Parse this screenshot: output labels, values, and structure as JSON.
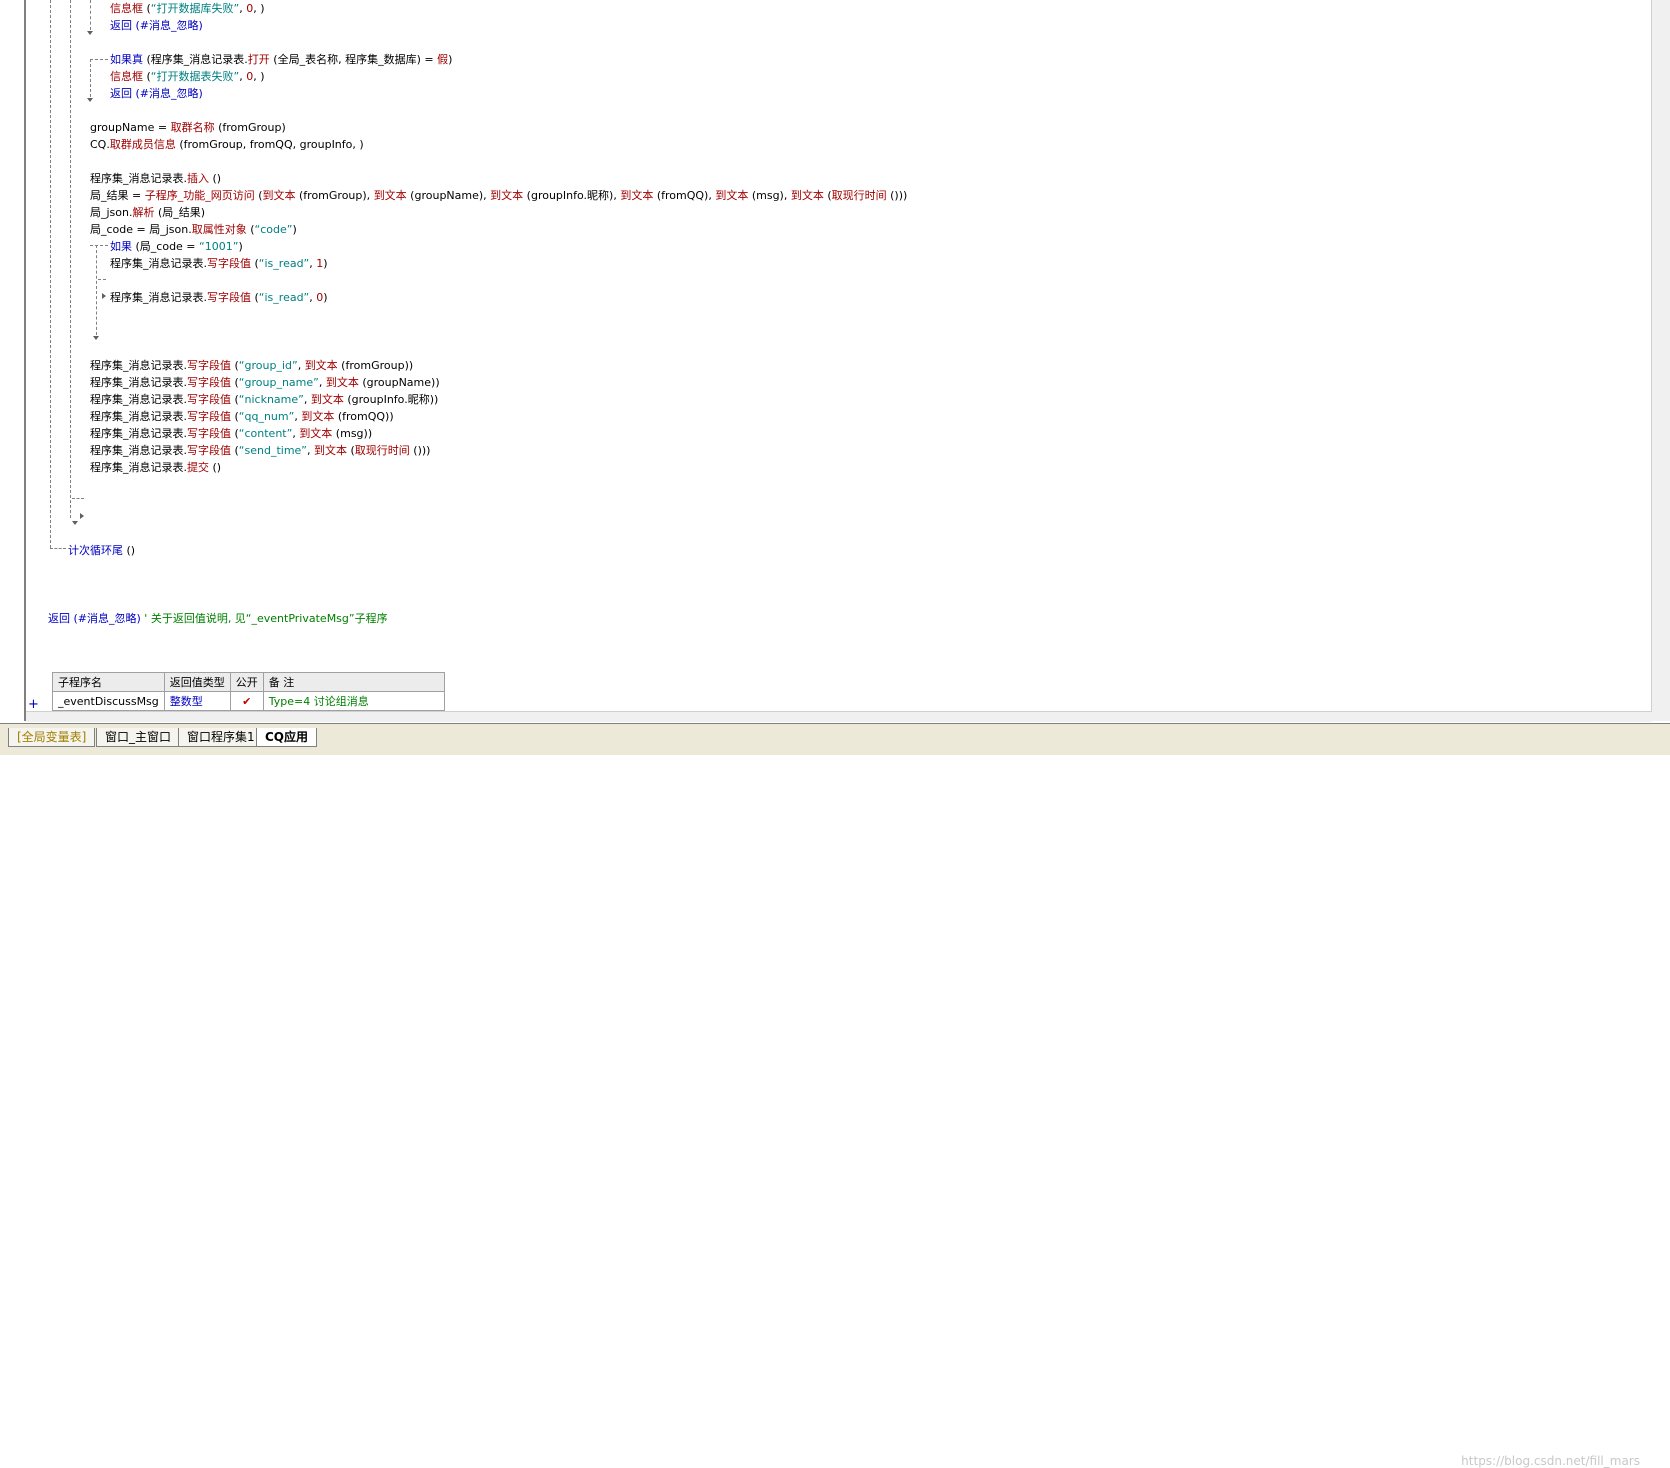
{
  "code_lines": [
    {
      "parts": [
        {
          "t": "信息框",
          "c": "f"
        },
        {
          "t": " (",
          "c": ""
        },
        {
          "t": "“打开数据库失败”",
          "c": "s"
        },
        {
          "t": ", ",
          "c": ""
        },
        {
          "t": "0",
          "c": "n"
        },
        {
          "t": ", )",
          "c": ""
        }
      ]
    },
    {
      "parts": [
        {
          "t": "返回",
          "c": "k"
        },
        {
          "t": " (#消息_忽略)",
          "c": "k"
        }
      ]
    },
    {
      "parts": [
        {
          "t": "如果真",
          "c": "k"
        },
        {
          "t": " (程序集_消息记录表.",
          "c": ""
        },
        {
          "t": "打开",
          "c": "f"
        },
        {
          "t": " (全局_表名称, 程序集_数据库) = ",
          "c": ""
        },
        {
          "t": "假",
          "c": "f"
        },
        {
          "t": ")",
          "c": ""
        }
      ]
    },
    {
      "parts": [
        {
          "t": "信息框",
          "c": "f"
        },
        {
          "t": " (",
          "c": ""
        },
        {
          "t": "“打开数据表失败”",
          "c": "s"
        },
        {
          "t": ", ",
          "c": ""
        },
        {
          "t": "0",
          "c": "n"
        },
        {
          "t": ", )",
          "c": ""
        }
      ]
    },
    {
      "parts": [
        {
          "t": "返回",
          "c": "k"
        },
        {
          "t": " (#消息_忽略)",
          "c": "k"
        }
      ]
    },
    {
      "parts": [
        {
          "t": "groupName = ",
          "c": ""
        },
        {
          "t": "取群名称",
          "c": "f"
        },
        {
          "t": " (fromGroup)",
          "c": ""
        }
      ]
    },
    {
      "parts": [
        {
          "t": "CQ.",
          "c": ""
        },
        {
          "t": "取群成员信息",
          "c": "f"
        },
        {
          "t": " (fromGroup, fromQQ, groupInfo, )",
          "c": ""
        }
      ]
    },
    {
      "parts": [
        {
          "t": "程序集_消息记录表.",
          "c": ""
        },
        {
          "t": "插入",
          "c": "f"
        },
        {
          "t": " ()",
          "c": ""
        }
      ]
    },
    {
      "parts": [
        {
          "t": "局_结果 = ",
          "c": ""
        },
        {
          "t": "子程序_功能_网页访问",
          "c": "f"
        },
        {
          "t": " (",
          "c": ""
        },
        {
          "t": "到文本",
          "c": "f"
        },
        {
          "t": " (fromGroup), ",
          "c": ""
        },
        {
          "t": "到文本",
          "c": "f"
        },
        {
          "t": " (groupName), ",
          "c": ""
        },
        {
          "t": "到文本",
          "c": "f"
        },
        {
          "t": " (groupInfo.昵称), ",
          "c": ""
        },
        {
          "t": "到文本",
          "c": "f"
        },
        {
          "t": " (fromQQ), ",
          "c": ""
        },
        {
          "t": "到文本",
          "c": "f"
        },
        {
          "t": " (msg), ",
          "c": ""
        },
        {
          "t": "到文本",
          "c": "f"
        },
        {
          "t": " (",
          "c": ""
        },
        {
          "t": "取现行时间",
          "c": "f"
        },
        {
          "t": " ()))",
          "c": ""
        }
      ]
    },
    {
      "parts": [
        {
          "t": "局_json.",
          "c": ""
        },
        {
          "t": "解析",
          "c": "f"
        },
        {
          "t": " (局_结果)",
          "c": ""
        }
      ]
    },
    {
      "parts": [
        {
          "t": "局_code = 局_json.",
          "c": ""
        },
        {
          "t": "取属性对象",
          "c": "f"
        },
        {
          "t": " (",
          "c": ""
        },
        {
          "t": "“code”",
          "c": "s"
        },
        {
          "t": ")",
          "c": ""
        }
      ]
    },
    {
      "parts": [
        {
          "t": "如果",
          "c": "k"
        },
        {
          "t": " (局_code = ",
          "c": ""
        },
        {
          "t": "“1001”",
          "c": "s"
        },
        {
          "t": ")",
          "c": ""
        }
      ]
    },
    {
      "parts": [
        {
          "t": "程序集_消息记录表.",
          "c": ""
        },
        {
          "t": "写字段值",
          "c": "f"
        },
        {
          "t": " (",
          "c": ""
        },
        {
          "t": "“is_read”",
          "c": "s"
        },
        {
          "t": ", ",
          "c": ""
        },
        {
          "t": "1",
          "c": "n"
        },
        {
          "t": ")",
          "c": ""
        }
      ]
    },
    {
      "parts": [
        {
          "t": "程序集_消息记录表.",
          "c": ""
        },
        {
          "t": "写字段值",
          "c": "f"
        },
        {
          "t": " (",
          "c": ""
        },
        {
          "t": "“is_read”",
          "c": "s"
        },
        {
          "t": ", ",
          "c": ""
        },
        {
          "t": "0",
          "c": "n"
        },
        {
          "t": ")",
          "c": ""
        }
      ]
    },
    {
      "parts": [
        {
          "t": "程序集_消息记录表.",
          "c": ""
        },
        {
          "t": "写字段值",
          "c": "f"
        },
        {
          "t": " (",
          "c": ""
        },
        {
          "t": "“group_id”",
          "c": "s"
        },
        {
          "t": ", ",
          "c": ""
        },
        {
          "t": "到文本",
          "c": "f"
        },
        {
          "t": " (fromGroup))",
          "c": ""
        }
      ]
    },
    {
      "parts": [
        {
          "t": "程序集_消息记录表.",
          "c": ""
        },
        {
          "t": "写字段值",
          "c": "f"
        },
        {
          "t": " (",
          "c": ""
        },
        {
          "t": "“group_name”",
          "c": "s"
        },
        {
          "t": ", ",
          "c": ""
        },
        {
          "t": "到文本",
          "c": "f"
        },
        {
          "t": " (groupName))",
          "c": ""
        }
      ]
    },
    {
      "parts": [
        {
          "t": "程序集_消息记录表.",
          "c": ""
        },
        {
          "t": "写字段值",
          "c": "f"
        },
        {
          "t": " (",
          "c": ""
        },
        {
          "t": "“nickname”",
          "c": "s"
        },
        {
          "t": ", ",
          "c": ""
        },
        {
          "t": "到文本",
          "c": "f"
        },
        {
          "t": " (groupInfo.昵称))",
          "c": ""
        }
      ]
    },
    {
      "parts": [
        {
          "t": "程序集_消息记录表.",
          "c": ""
        },
        {
          "t": "写字段值",
          "c": "f"
        },
        {
          "t": " (",
          "c": ""
        },
        {
          "t": "“qq_num”",
          "c": "s"
        },
        {
          "t": ", ",
          "c": ""
        },
        {
          "t": "到文本",
          "c": "f"
        },
        {
          "t": " (fromQQ))",
          "c": ""
        }
      ]
    },
    {
      "parts": [
        {
          "t": "程序集_消息记录表.",
          "c": ""
        },
        {
          "t": "写字段值",
          "c": "f"
        },
        {
          "t": " (",
          "c": ""
        },
        {
          "t": "“content”",
          "c": "s"
        },
        {
          "t": ", ",
          "c": ""
        },
        {
          "t": "到文本",
          "c": "f"
        },
        {
          "t": " (msg))",
          "c": ""
        }
      ]
    },
    {
      "parts": [
        {
          "t": "程序集_消息记录表.",
          "c": ""
        },
        {
          "t": "写字段值",
          "c": "f"
        },
        {
          "t": " (",
          "c": ""
        },
        {
          "t": "“send_time”",
          "c": "s"
        },
        {
          "t": ", ",
          "c": ""
        },
        {
          "t": "到文本",
          "c": "f"
        },
        {
          "t": " (",
          "c": ""
        },
        {
          "t": "取现行时间",
          "c": "f"
        },
        {
          "t": " ()))",
          "c": ""
        }
      ]
    },
    {
      "parts": [
        {
          "t": "程序集_消息记录表.",
          "c": ""
        },
        {
          "t": "提交",
          "c": "f"
        },
        {
          "t": " ()",
          "c": ""
        }
      ]
    },
    {
      "parts": [
        {
          "t": "计次循环尾",
          "c": "k"
        },
        {
          "t": " ()",
          "c": ""
        }
      ]
    },
    {
      "parts": [
        {
          "t": "返回",
          "c": "k"
        },
        {
          "t": " (#消息_忽略) ",
          "c": "k"
        },
        {
          "t": "' 关于返回值说明, 见“_eventPrivateMsg”子程序",
          "c": "c"
        }
      ]
    }
  ],
  "sub_table": {
    "headers": [
      "子程序名",
      "返回值类型",
      "公开",
      "备 注"
    ],
    "row": {
      "name": "_eventDiscussMsg",
      "return_type": "整数型",
      "public": "✔",
      "note": "Type=4 讨论组消息"
    }
  },
  "expand_symbol": "+",
  "tabs": [
    {
      "label": "[全局变量表]",
      "active": false
    },
    {
      "label": "窗口_主窗口",
      "active": false
    },
    {
      "label": "窗口程序集1",
      "active": false
    },
    {
      "label": "CQ应用",
      "active": true
    }
  ],
  "watermark": "https://blog.csdn.net/fill_mars",
  "colors": {
    "keyword": "#0000c0",
    "function": "#a00000",
    "string": "#008080",
    "comment": "#008000"
  }
}
